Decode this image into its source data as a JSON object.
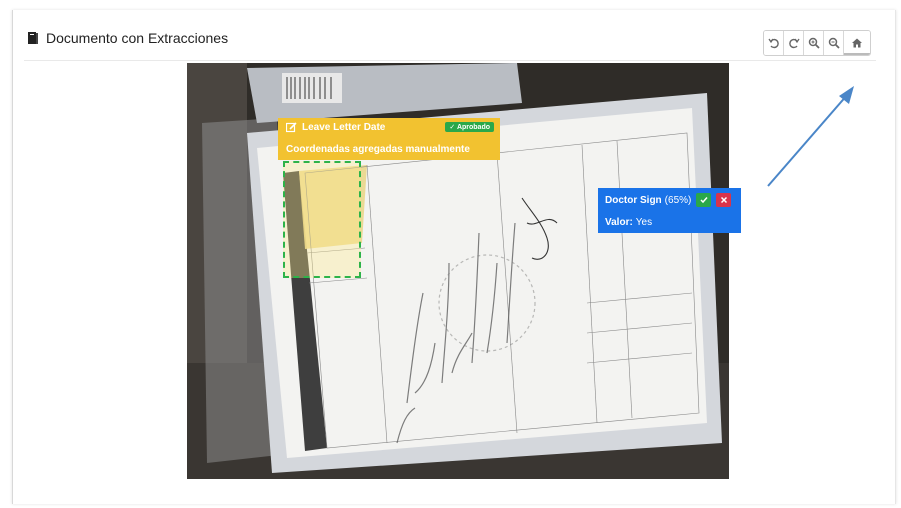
{
  "header": {
    "title": "Documento con Extracciones"
  },
  "toolbar": {
    "buttons": [
      {
        "name": "rotate-left"
      },
      {
        "name": "rotate-right"
      },
      {
        "name": "zoom-in"
      },
      {
        "name": "zoom-out"
      },
      {
        "name": "home"
      }
    ]
  },
  "extractions": {
    "leave": {
      "title": "Leave Letter Date",
      "badge": "✓ Aprobado",
      "note": "Coordenadas agregadas manualmente",
      "color": "#f2c230"
    },
    "doctor": {
      "title": "Doctor Sign",
      "confidence": "(65%)",
      "value_label": "Valor:",
      "value": "Yes",
      "color": "#1a73e8"
    }
  },
  "colors": {
    "accept": "#2aa84a",
    "reject": "#d9334a",
    "dashed_border": "#2db34a",
    "arrow": "#4a86c8"
  }
}
